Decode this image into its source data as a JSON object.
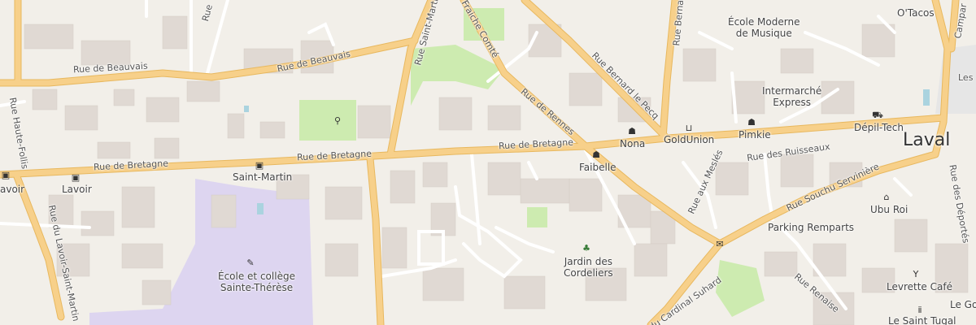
{
  "city": "Laval",
  "streets": {
    "beauvais_w": "Rue de Beauvais",
    "beauvais_e": "Rue de Beauvais",
    "bretagne_w": "Rue de Bretagne",
    "bretagne_m": "Rue de Bretagne",
    "bretagne_e": "Rue de Bretagne",
    "haute_follis": "Rue Haute-Follis",
    "lavoir_st_martin": "Rue du Lavoir-Saint-Martin",
    "saint_martin": "Rue Saint-Martin",
    "fraiche_comte": "Fraiche Comté",
    "rennes": "Rue de Rennes",
    "bernard_le_pecq": "Rue Bernard le Pecq",
    "bernard_top": "Rue Bernard le",
    "ruisseaux": "Rue des Ruisseaux",
    "mesles": "Rue aux Meslés",
    "souchu": "Rue Souchu Servinière",
    "deportes": "Rue des Déportés",
    "renaise": "Rue Renaise",
    "cardinal": "du Cardinal Suhard",
    "camp": "Campar",
    "les": "Les",
    "rue_top": "Rue"
  },
  "pois": {
    "lavoir_w": "avoir",
    "lavoir": "Lavoir",
    "saint_martin": "Saint-Martin",
    "ecole_st_therese": "École et collège\nSainte-Thérèse",
    "ecole_musique": "École Moderne\nde Musique",
    "otacos": "O'Tacos",
    "intermarche": "Intermarché\nExpress",
    "depil_tech": "Dépil-Tech",
    "pimkie": "Pimkie",
    "goldunion": "GoldUnion",
    "nona": "Nona",
    "faibelle": "Faibelle",
    "jardin": "Jardin des\nCordeliers",
    "ubu_roi": "Ubu Roi",
    "parking": "Parking Remparts",
    "levrette": "Levrette Café",
    "saint_tugal": "Le Saint Tugal",
    "le_go": "Le Go"
  },
  "icons": {
    "bus": "bus-stop-icon",
    "shirt": "clothes-shop-icon",
    "basket": "supermarket-icon",
    "bag": "shop-bag-icon",
    "tree": "park-tree-icon",
    "school": "school-icon",
    "theatre": "theatre-icon",
    "post": "post-office-icon",
    "bar": "bar-icon",
    "restaurant": "restaurant-icon",
    "playground": "playground-icon"
  },
  "colors": {
    "background": "#f2efe9",
    "building": "#e0d9d3",
    "major_road": "#f7d08a",
    "major_road_casing": "#e8b85f",
    "minor_road": "#ffffff",
    "park": "#cdebb0",
    "school_area": "#dcd5f0",
    "water": "#aad3df"
  }
}
